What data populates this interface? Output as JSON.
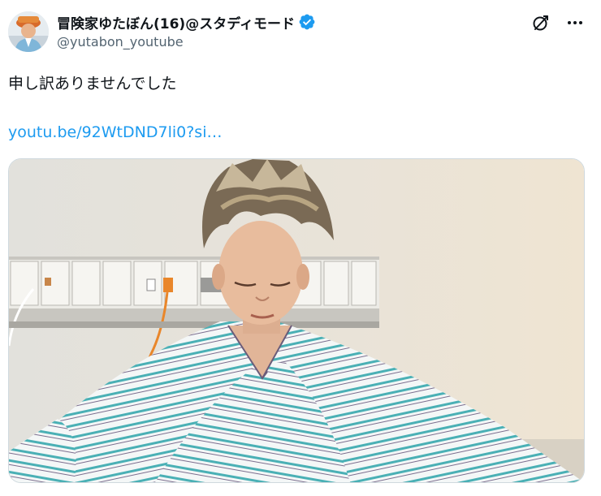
{
  "author": {
    "display_name": "冒険家ゆたぼん(16)@スタディモード",
    "handle": "@yutabon_youtube",
    "verified": true,
    "avatar_icon": "profile-photo"
  },
  "actions": {
    "grok_icon": "grok-icon",
    "more_icon": "more-dots-icon"
  },
  "tweet": {
    "text": "申し訳ありませんでした",
    "link_text": "youtu.be/92WtDND7li0?si…"
  },
  "media": {
    "icon": "photo"
  },
  "colors": {
    "link": "#1d9bf0",
    "verified": "#1d9bf0",
    "secondary_text": "#536471"
  }
}
